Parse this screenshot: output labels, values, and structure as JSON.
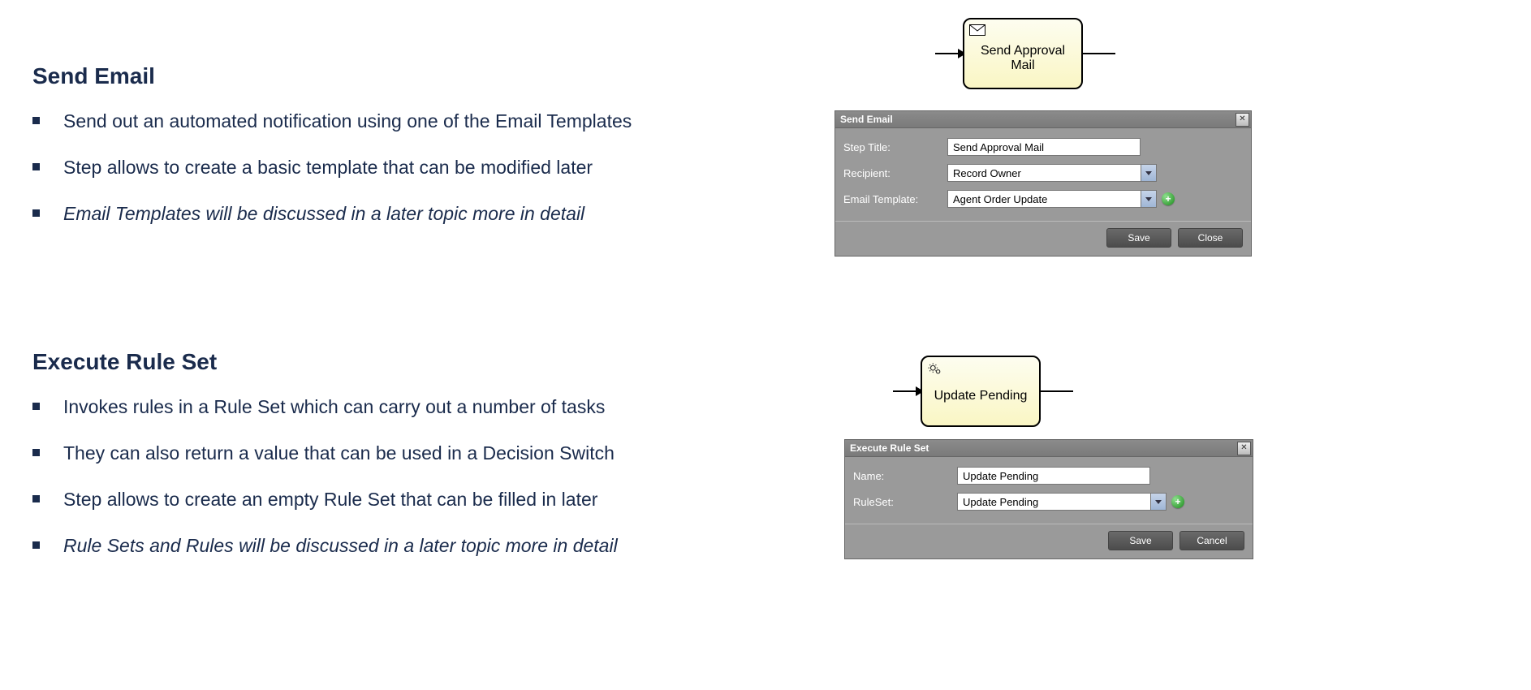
{
  "section1": {
    "title": "Send Email",
    "bullets": [
      {
        "text": "Send out an automated notification using one of the Email Templates",
        "italic": false
      },
      {
        "text": "Step allows to create a basic template that can be modified later",
        "italic": false
      },
      {
        "text": "Email Templates will be discussed in a later topic more in detail",
        "italic": true
      }
    ],
    "node": {
      "icon": "mail-icon",
      "label": "Send Approval Mail"
    },
    "dialog": {
      "title": "Send Email",
      "fields": {
        "step_title_label": "Step Title:",
        "step_title_value": "Send Approval Mail",
        "recipient_label": "Recipient:",
        "recipient_value": "Record Owner",
        "template_label": "Email Template:",
        "template_value": "Agent Order Update"
      },
      "buttons": {
        "save": "Save",
        "close": "Close"
      }
    }
  },
  "section2": {
    "title": "Execute Rule Set",
    "bullets": [
      {
        "text": "Invokes rules in a Rule Set which can carry out a number of tasks",
        "italic": false
      },
      {
        "text": "They can also return a value that can be used in a Decision Switch",
        "italic": false
      },
      {
        "text": "Step allows to create an empty Rule Set that can be filled in later",
        "italic": false
      },
      {
        "text": "Rule Sets and Rules will be discussed in a later topic more in detail",
        "italic": true
      }
    ],
    "node": {
      "icon": "gear-icon",
      "label": "Update Pending"
    },
    "dialog": {
      "title": "Execute Rule Set",
      "fields": {
        "name_label": "Name:",
        "name_value": "Update Pending",
        "ruleset_label": "RuleSet:",
        "ruleset_value": "Update Pending"
      },
      "buttons": {
        "save": "Save",
        "cancel": "Cancel"
      }
    }
  }
}
